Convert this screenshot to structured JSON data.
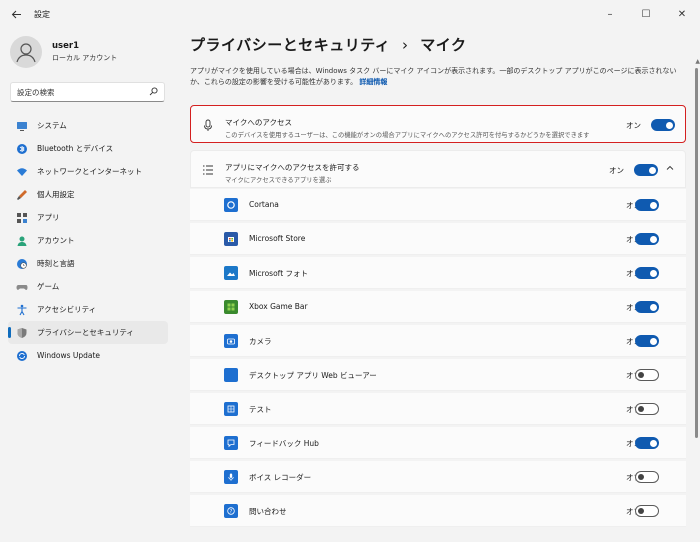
{
  "window": {
    "title": "設定",
    "controls": [
      "–",
      "☐",
      "✕"
    ]
  },
  "user": {
    "name": "user1",
    "account_type": "ローカル アカウント"
  },
  "search": {
    "placeholder": "設定の検索"
  },
  "nav": {
    "items": [
      {
        "label": "システム",
        "icon": "monitor-icon"
      },
      {
        "label": "Bluetooth とデバイス",
        "icon": "bluetooth-icon"
      },
      {
        "label": "ネットワークとインターネット",
        "icon": "wifi-icon"
      },
      {
        "label": "個人用設定",
        "icon": "brush-icon"
      },
      {
        "label": "アプリ",
        "icon": "apps-icon"
      },
      {
        "label": "アカウント",
        "icon": "person-icon"
      },
      {
        "label": "時刻と言語",
        "icon": "globe-clock-icon"
      },
      {
        "label": "ゲーム",
        "icon": "gamepad-icon"
      },
      {
        "label": "アクセシビリティ",
        "icon": "accessibility-icon"
      },
      {
        "label": "プライバシーとセキュリティ",
        "icon": "shield-icon",
        "active": true
      },
      {
        "label": "Windows Update",
        "icon": "update-icon"
      }
    ]
  },
  "main": {
    "breadcrumb_parent": "プライバシーとセキュリティ",
    "breadcrumb_sep": "›",
    "breadcrumb_current": "マイク",
    "description": "アプリがマイクを使用している場合は、Windows タスク バーにマイク アイコンが表示されます。一部のデスクトップ アプリがこのページに表示されないか、これらの設定の影響を受ける可能性があります。",
    "description_link": "詳細情報",
    "mic_access": {
      "title": "マイクへのアクセス",
      "subtitle": "このデバイスを使用するユーザーは、この機能がオンの場合アプリにマイクへのアクセス許可を付与するかどうかを選択できます",
      "state_label": "オン"
    },
    "app_access": {
      "title": "アプリにマイクへのアクセスを許可する",
      "subtitle": "マイクにアクセスできるアプリを選ぶ",
      "state_label": "オン",
      "chevron": "^"
    },
    "apps": [
      {
        "name": "Cortana",
        "state": "オン",
        "on": true,
        "color": "#1e6fd0"
      },
      {
        "name": "Microsoft Store",
        "state": "オン",
        "on": true,
        "color": "#2a5aa8"
      },
      {
        "name": "Microsoft フォト",
        "state": "オン",
        "on": true,
        "color": "#1c78c8"
      },
      {
        "name": "Xbox Game Bar",
        "state": "オン",
        "on": true,
        "color": "#3a8a2e"
      },
      {
        "name": "カメラ",
        "state": "オン",
        "on": true,
        "color": "#1e6fd0"
      },
      {
        "name": "デスクトップ アプリ Web ビューアー",
        "state": "オフ",
        "on": false,
        "color": "#1e6fd0"
      },
      {
        "name": "テスト",
        "state": "オフ",
        "on": false,
        "color": "#1e6fd0"
      },
      {
        "name": "フィードバック Hub",
        "state": "オン",
        "on": true,
        "color": "#1e6fd0"
      },
      {
        "name": "ボイス レコーダー",
        "state": "オフ",
        "on": false,
        "color": "#1e6fd0"
      },
      {
        "name": "問い合わせ",
        "state": "オフ",
        "on": false,
        "color": "#1e6fd0"
      }
    ]
  },
  "colors": {
    "accent": "#0f5ab0",
    "highlight_border": "#d42020",
    "background": "#f3f3f3"
  }
}
